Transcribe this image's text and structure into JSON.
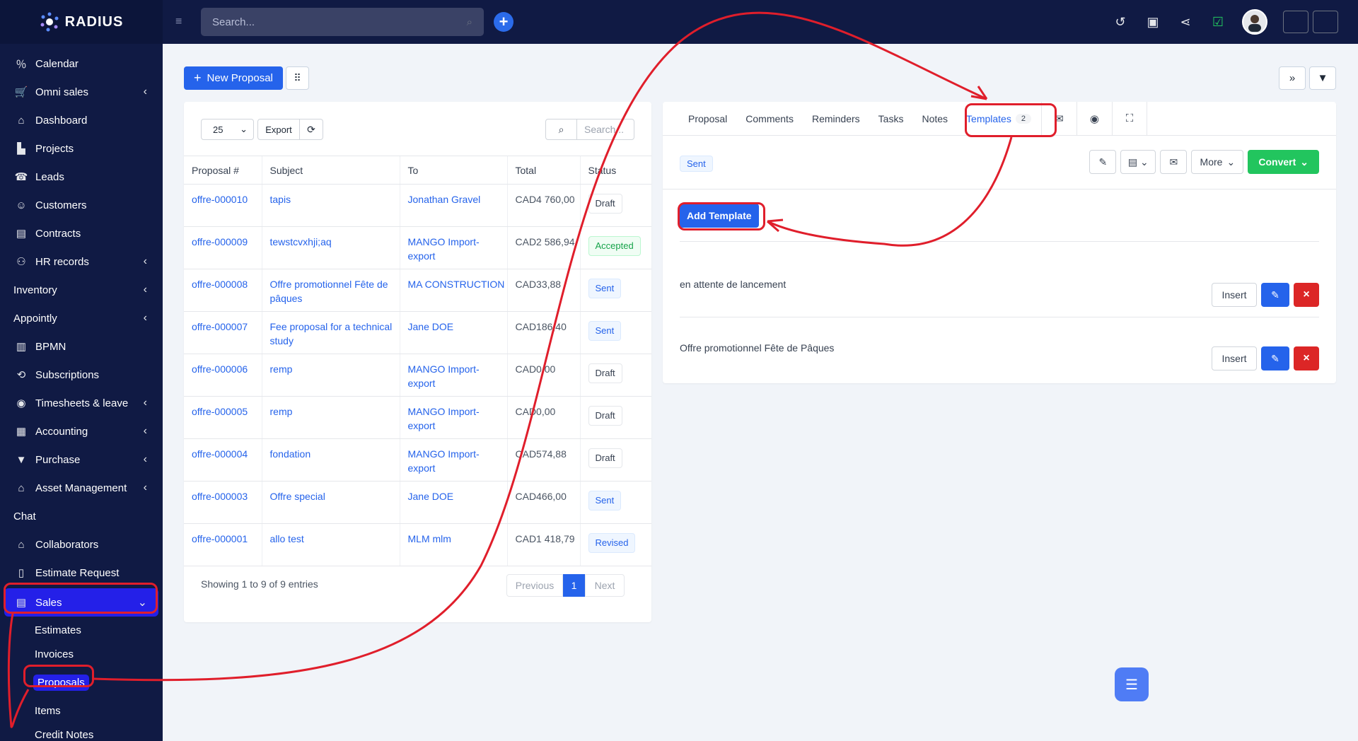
{
  "app": {
    "brand": "RADIUS"
  },
  "sidebar": {
    "items": [
      {
        "label": "Calendar",
        "icon": "calendar-icon",
        "chevron": false
      },
      {
        "label": "Omni sales",
        "icon": "basket-icon",
        "chevron": true
      },
      {
        "label": "Dashboard",
        "icon": "home-icon",
        "chevron": false
      },
      {
        "label": "Projects",
        "icon": "chart-icon",
        "chevron": false
      },
      {
        "label": "Leads",
        "icon": "tty-icon",
        "chevron": false
      },
      {
        "label": "Customers",
        "icon": "user-icon",
        "chevron": false
      },
      {
        "label": "Contracts",
        "icon": "file-icon",
        "chevron": false
      },
      {
        "label": "HR records",
        "icon": "users-icon",
        "chevron": true
      },
      {
        "label": "Inventory",
        "icon": "",
        "chevron": true
      },
      {
        "label": "Appointly",
        "icon": "",
        "chevron": true
      },
      {
        "label": "BPMN",
        "icon": "map-icon",
        "chevron": false
      },
      {
        "label": "Subscriptions",
        "icon": "repeat-icon",
        "chevron": false
      },
      {
        "label": "Timesheets & leave",
        "icon": "user-circle-icon",
        "chevron": true
      },
      {
        "label": "Accounting",
        "icon": "calculator-icon",
        "chevron": true
      },
      {
        "label": "Purchase",
        "icon": "cart-icon",
        "chevron": true
      },
      {
        "label": "Asset Management",
        "icon": "bank-icon",
        "chevron": true
      },
      {
        "label": "Chat",
        "icon": "",
        "chevron": false
      },
      {
        "label": "Collaborators",
        "icon": "bank-icon",
        "chevron": false
      },
      {
        "label": "Estimate Request",
        "icon": "file-outline-icon",
        "chevron": false
      },
      {
        "label": "Sales",
        "icon": "receipt-icon",
        "chevron": true
      }
    ],
    "sales_sub": [
      "Estimates",
      "Invoices",
      "Proposals",
      "Items",
      "Credit Notes"
    ]
  },
  "topbar": {
    "search_placeholder": "Search...",
    "icons": [
      "history-icon",
      "id-card-icon",
      "share-icon",
      "monitor-check-icon"
    ]
  },
  "toolbar": {
    "new_proposal": "New Proposal"
  },
  "list": {
    "page_size": "25",
    "export": "Export",
    "search_placeholder": "Search...",
    "columns": [
      "Proposal #",
      "Subject",
      "To",
      "Total",
      "Status"
    ],
    "rows": [
      {
        "num": "offre-000010",
        "subject": "tapis",
        "to": "Jonathan Gravel",
        "total": "CAD4 760,00",
        "status": "Draft",
        "kind": "draft"
      },
      {
        "num": "offre-000009",
        "subject": "tewstcvxhji;aq",
        "to": "MANGO Import-export",
        "total": "CAD2 586,94",
        "status": "Accepted",
        "kind": "accepted"
      },
      {
        "num": "offre-000008",
        "subject": "Offre promotionnel Fête de pâques",
        "to": "MA CONSTRUCTION",
        "total": "CAD33,88",
        "status": "Sent",
        "kind": "sent"
      },
      {
        "num": "offre-000007",
        "subject": "Fee proposal for a technical study",
        "to": "Jane DOE",
        "total": "CAD186,40",
        "status": "Sent",
        "kind": "sent"
      },
      {
        "num": "offre-000006",
        "subject": "remp",
        "to": "MANGO Import-export",
        "total": "CAD0,00",
        "status": "Draft",
        "kind": "draft"
      },
      {
        "num": "offre-000005",
        "subject": "remp",
        "to": "MANGO Import-export",
        "total": "CAD0,00",
        "status": "Draft",
        "kind": "draft"
      },
      {
        "num": "offre-000004",
        "subject": "fondation",
        "to": "MANGO Import-export",
        "total": "CAD574,88",
        "status": "Draft",
        "kind": "draft"
      },
      {
        "num": "offre-000003",
        "subject": "Offre special",
        "to": "Jane DOE",
        "total": "CAD466,00",
        "status": "Sent",
        "kind": "sent"
      },
      {
        "num": "offre-000001",
        "subject": "allo test",
        "to": "MLM mlm",
        "total": "CAD1 418,79",
        "status": "Revised",
        "kind": "revised"
      }
    ],
    "showing": "Showing 1 to 9 of 9 entries",
    "pager": {
      "prev": "Previous",
      "page": "1",
      "next": "Next"
    }
  },
  "detail": {
    "tabs": [
      "Proposal",
      "Comments",
      "Reminders",
      "Tasks",
      "Notes"
    ],
    "templates_tab": {
      "label": "Templates",
      "count": "2"
    },
    "status": "Sent",
    "more": "More",
    "convert": "Convert",
    "add_template": "Add Template",
    "templates": [
      {
        "name": "en attente de lancement",
        "insert": "Insert"
      },
      {
        "name": "Offre promotionnel Fête de Pâques",
        "insert": "Insert"
      }
    ]
  },
  "colors": {
    "sidebar_bg": "#101a44",
    "accent": "#2563eb",
    "active_nav": "#2420e8",
    "convert": "#22c55e",
    "danger": "#dc2626",
    "annotation": "#e01e2b"
  }
}
